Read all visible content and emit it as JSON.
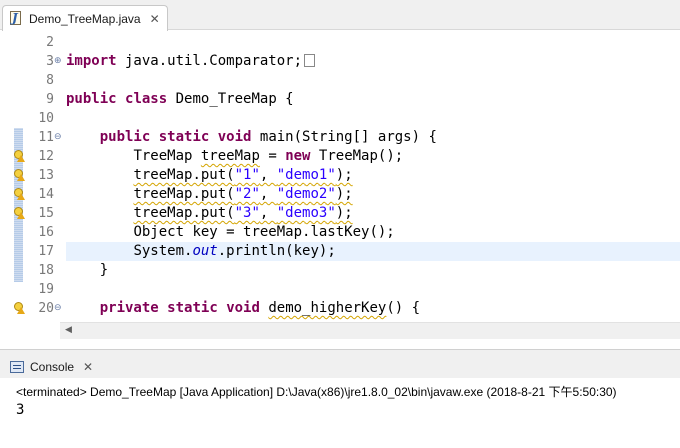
{
  "editor": {
    "tab": {
      "title": "Demo_TreeMap.java",
      "close": "✕",
      "icon": "java-file-icon"
    }
  },
  "code": {
    "lines": [
      {
        "num": "2"
      },
      {
        "num": "3",
        "fold": "⊕",
        "parts": {
          "kw": "import",
          "rest": " java.util.Comparator;"
        }
      },
      {
        "num": "8"
      },
      {
        "num": "9",
        "parts": {
          "kw1": "public",
          "kw2": "class",
          "rest": " Demo_TreeMap {"
        }
      },
      {
        "num": "10"
      },
      {
        "num": "11",
        "fold": "⊖",
        "parts": {
          "indent": "    ",
          "kw1": "public",
          "kw2": "static",
          "kw3": "void",
          "rest": " main(String[] args) {"
        }
      },
      {
        "num": "12",
        "parts": {
          "indent": "        ",
          "a": "TreeMap ",
          "w": "treeMap",
          "b": " = ",
          "kw": "new",
          "c": " TreeMap();"
        }
      },
      {
        "num": "13",
        "parts": {
          "indent": "        ",
          "w1": "treeMap.put(",
          "s1": "\"1\"",
          "m": ", ",
          "s2": "\"demo1\"",
          "w2": ");"
        }
      },
      {
        "num": "14",
        "parts": {
          "indent": "        ",
          "w1": "treeMap.put(",
          "s1": "\"2\"",
          "m": ", ",
          "s2": "\"demo2\"",
          "w2": ");"
        }
      },
      {
        "num": "15",
        "parts": {
          "indent": "        ",
          "w1": "treeMap.put(",
          "s1": "\"3\"",
          "m": ", ",
          "s2": "\"demo3\"",
          "w2": ");"
        }
      },
      {
        "num": "16",
        "parts": {
          "indent": "        ",
          "text": "Object key = treeMap.lastKey();"
        }
      },
      {
        "num": "17",
        "parts": {
          "indent": "        ",
          "a": "System.",
          "fld": "out",
          "b": ".println(key);"
        }
      },
      {
        "num": "18",
        "parts": {
          "indent": "    ",
          "text": "}"
        }
      },
      {
        "num": "19"
      },
      {
        "num": "20",
        "fold": "⊖",
        "parts": {
          "indent": "    ",
          "kw1": "private",
          "kw2": "static",
          "kw3": "void",
          "sp": " ",
          "w": "demo_higherKey",
          "rest": "() {"
        }
      }
    ]
  },
  "scrollbar": {
    "left_arrow": "◀"
  },
  "console": {
    "tab": {
      "title": "Console",
      "close": "✕",
      "icon": "console-icon"
    },
    "status": "<terminated> Demo_TreeMap [Java Application] D:\\Java(x86)\\jre1.8.0_02\\bin\\javaw.exe (2018-8-21 下午5:50:30)",
    "output": "3"
  }
}
